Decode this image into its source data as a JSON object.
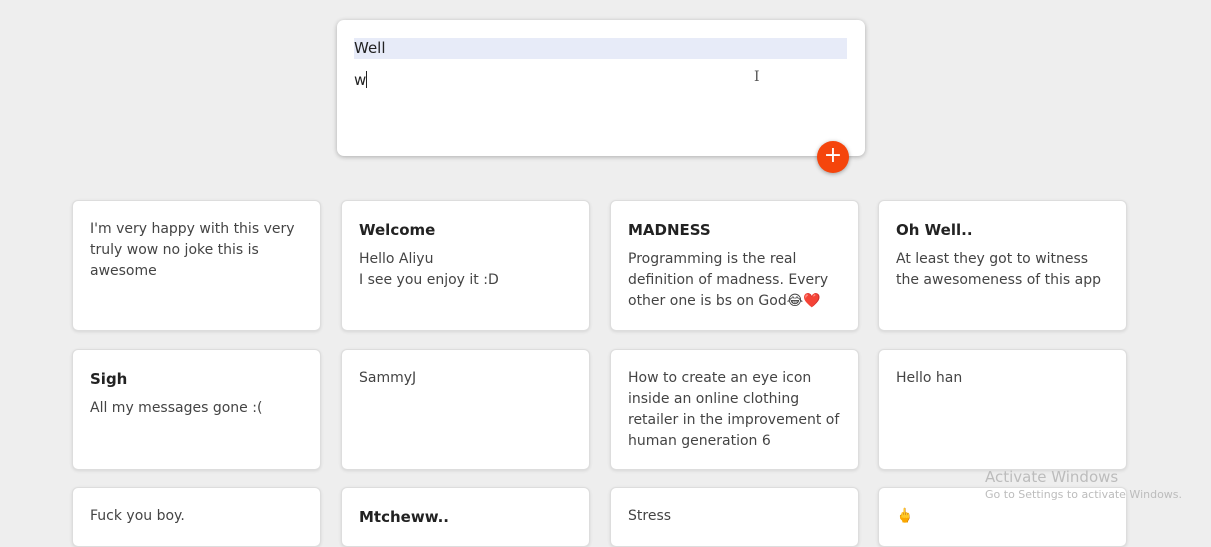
{
  "composer": {
    "title": "Well",
    "content": "w",
    "add_label": "+"
  },
  "notes": [
    {
      "title": "",
      "content": "I'm very happy with this very truly wow no joke this is awesome"
    },
    {
      "title": "Welcome",
      "content": "Hello Aliyu\nI see you enjoy it :D"
    },
    {
      "title": "MADNESS",
      "content": "Programming is the real definition of madness. Every other one is bs on God😂❤️"
    },
    {
      "title": "Oh Well..",
      "content": "At least they got to witness the awesomeness of this app"
    },
    {
      "title": "Sigh",
      "content": "All my messages gone :("
    },
    {
      "title": "",
      "content": "SammyJ"
    },
    {
      "title": "",
      "content": "How to create an eye icon inside an online clothing retailer in the improvement of human generation 6"
    },
    {
      "title": "",
      "content": "Hello han"
    },
    {
      "title": "",
      "content": "Fuck you boy."
    },
    {
      "title": "Mtcheww..",
      "content": ""
    },
    {
      "title": "",
      "content": "Stress"
    },
    {
      "title": "",
      "content": "🖕"
    }
  ],
  "watermark": {
    "title": "Activate Windows",
    "subtitle": "Go to Settings to activate Windows."
  },
  "colors": {
    "background": "#eeeeee",
    "accent": "#f5450c",
    "title_highlight": "#e7ebf8"
  }
}
